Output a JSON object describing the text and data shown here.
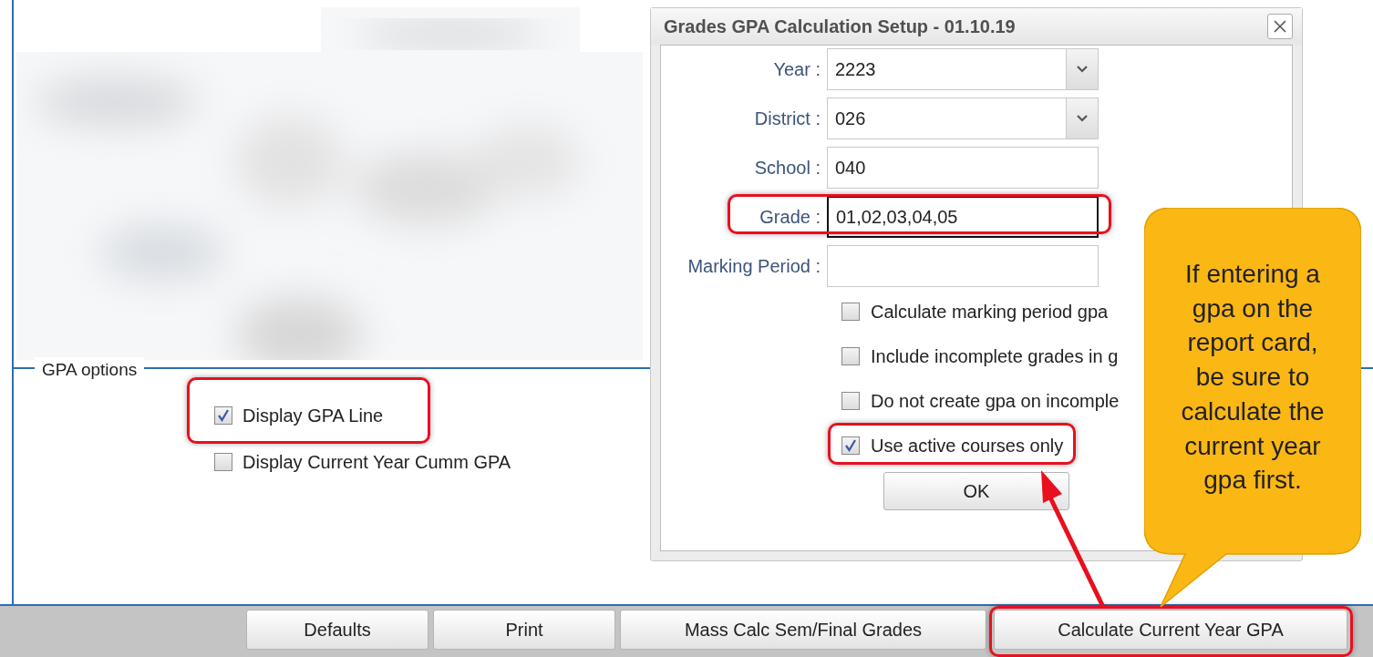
{
  "gpa_options": {
    "title": "GPA options",
    "items": [
      {
        "label": "Display GPA Line",
        "checked": true,
        "highlighted": true
      },
      {
        "label": "Display Current Year Cumm GPA",
        "checked": false,
        "highlighted": false
      }
    ]
  },
  "buttons": [
    {
      "label": "Defaults",
      "highlighted": false
    },
    {
      "label": "Print",
      "highlighted": false
    },
    {
      "label": "Mass Calc Sem/Final Grades",
      "highlighted": false
    },
    {
      "label": "Calculate Current Year GPA",
      "highlighted": true
    }
  ],
  "dialog": {
    "title": "Grades GPA Calculation Setup - 01.10.19",
    "fields": [
      {
        "label": "Year :",
        "value": "2223",
        "kind": "select",
        "focused": false,
        "highlighted": false
      },
      {
        "label": "District :",
        "value": "026",
        "kind": "select",
        "focused": false,
        "highlighted": false
      },
      {
        "label": "School :",
        "value": "040",
        "kind": "text",
        "focused": false,
        "highlighted": false
      },
      {
        "label": "Grade :",
        "value": "01,02,03,04,05",
        "kind": "text",
        "focused": true,
        "highlighted": true
      },
      {
        "label": "Marking Period :",
        "kind": "text",
        "focused": false,
        "highlighted": false
      }
    ],
    "options": [
      {
        "label": "Calculate marking period gpa",
        "checked": false,
        "highlighted": false
      },
      {
        "label": "Include incomplete grades in g",
        "checked": false,
        "highlighted": false
      },
      {
        "label": "Do not create gpa on incomple",
        "checked": false,
        "highlighted": false
      },
      {
        "label": "Use active courses only",
        "checked": true,
        "highlighted": true
      }
    ],
    "ok": "OK"
  },
  "callout": {
    "text": "If entering a gpa on the report card, be sure to calculate the current year gpa first."
  }
}
